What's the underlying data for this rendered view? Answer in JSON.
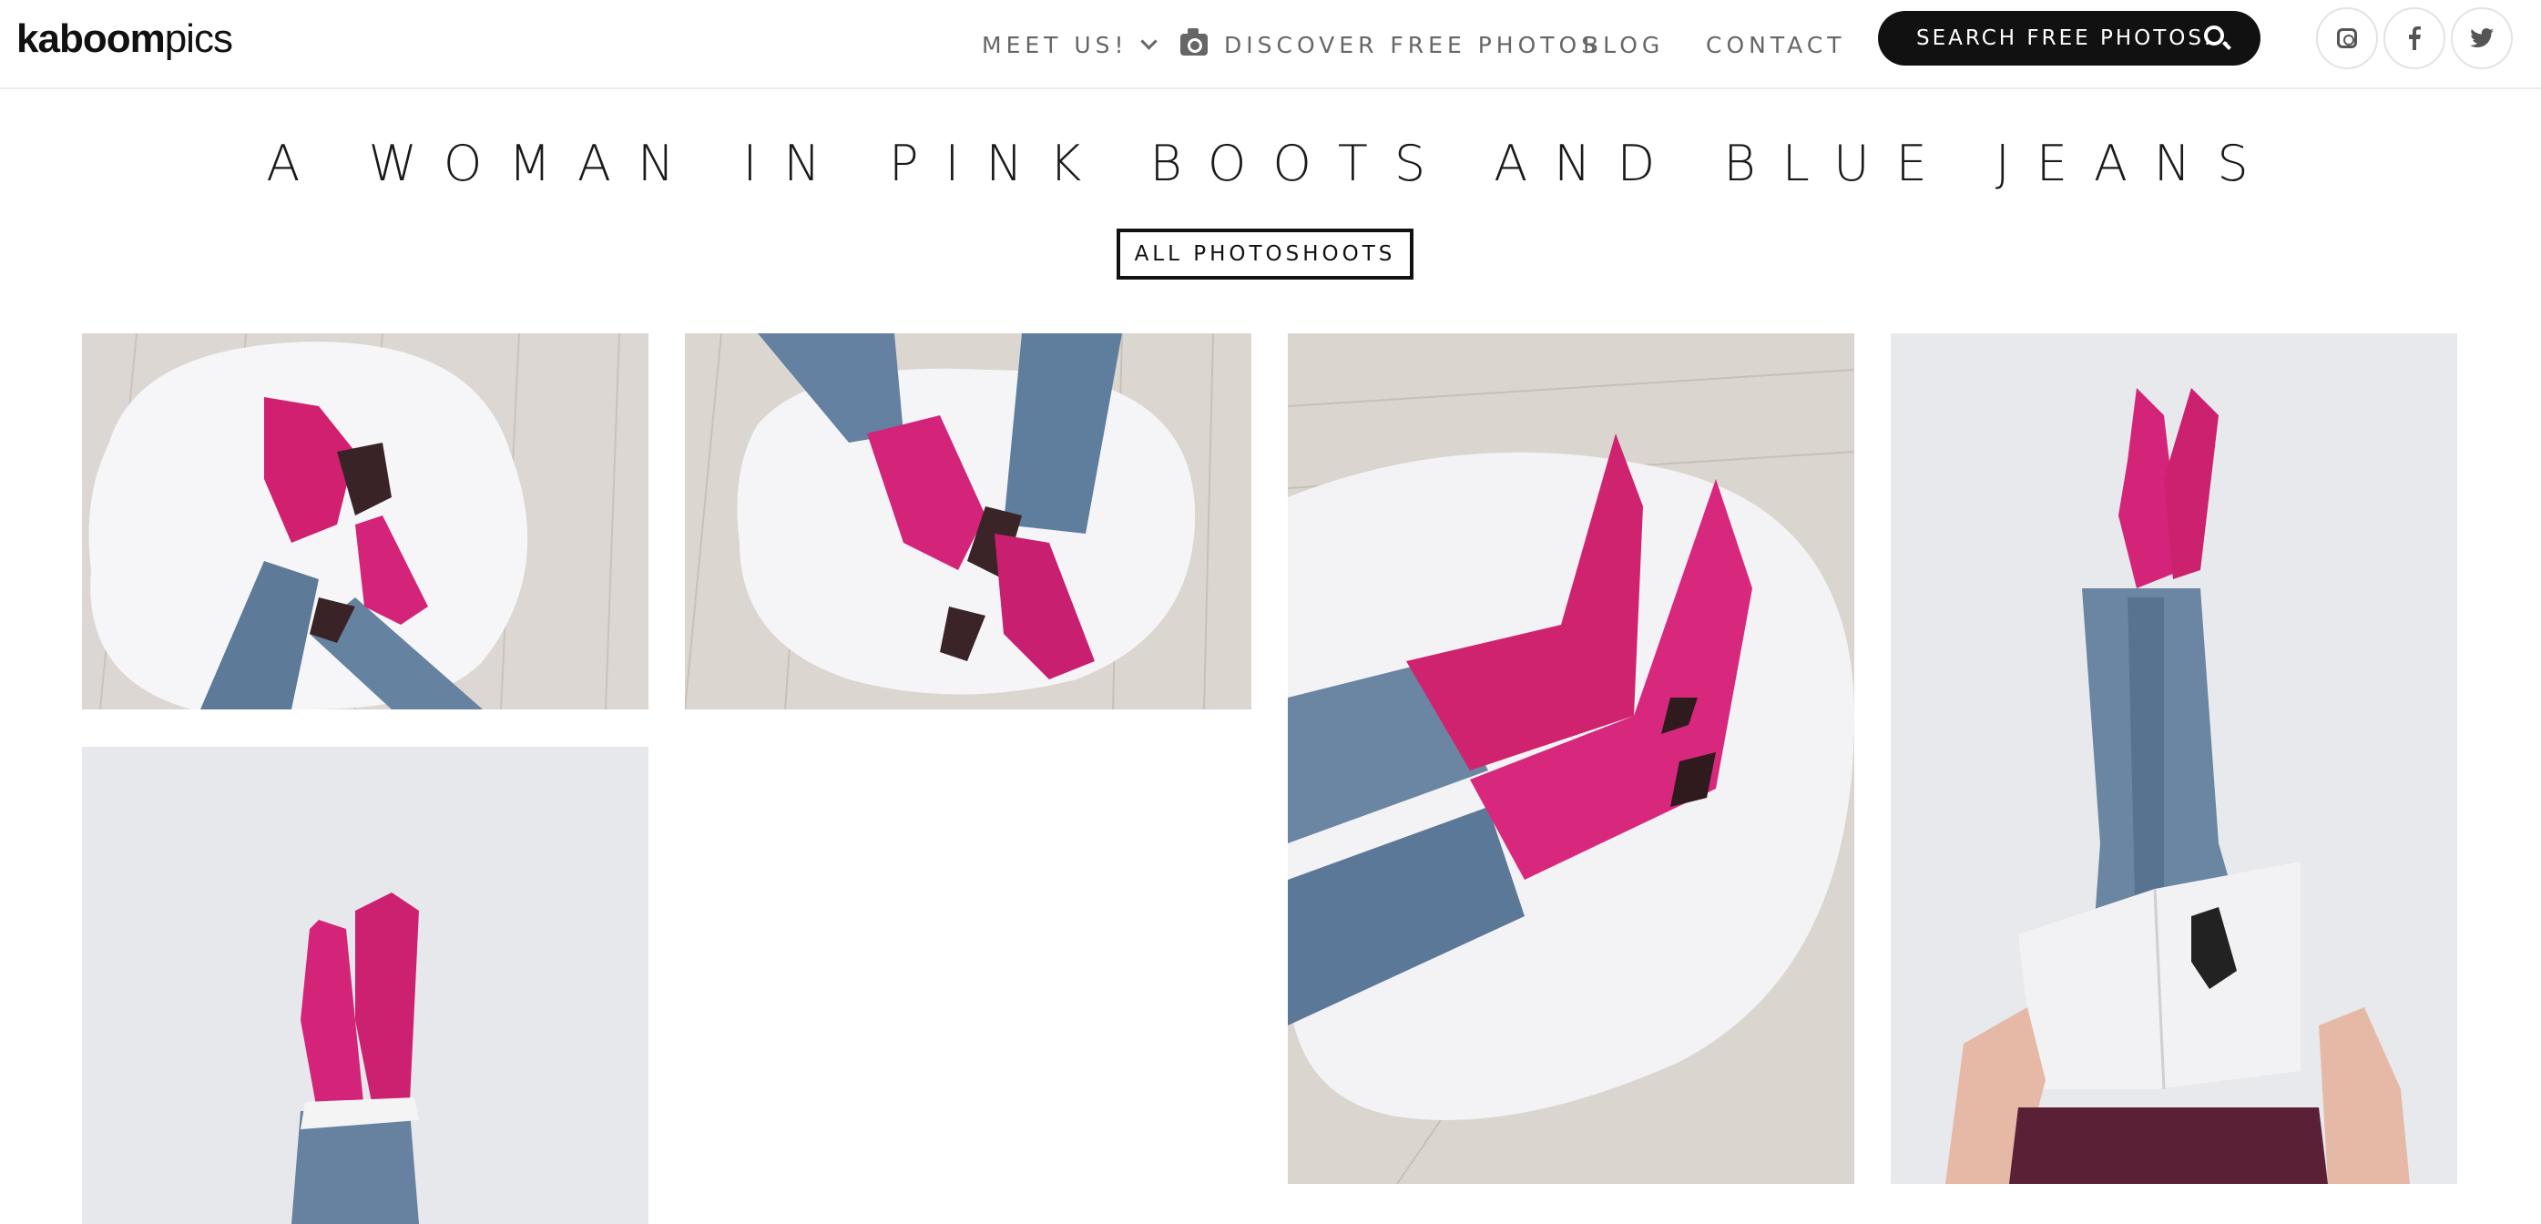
{
  "header": {
    "logo_bold": "kaboom",
    "logo_light": "pics",
    "nav": [
      {
        "label": "MEET US!"
      },
      {
        "label": "DISCOVER FREE PHOTOS"
      },
      {
        "label": "BLOG"
      },
      {
        "label": "CONTACT"
      }
    ],
    "search_placeholder": "SEARCH FREE PHOTOS...",
    "social": [
      "instagram-icon",
      "facebook-icon",
      "twitter-icon"
    ]
  },
  "main": {
    "title": "A WOMAN IN PINK BOOTS AND BLUE JEANS",
    "all_photoshoots_label": "ALL PHOTOSHOOTS"
  },
  "colors": {
    "boot_pink": "#d3247a",
    "denim": "#5f7e9e",
    "rug_white": "#f4f4f6",
    "floor_wood": "#dcd7d1",
    "background_grey": "#e9eaee"
  }
}
